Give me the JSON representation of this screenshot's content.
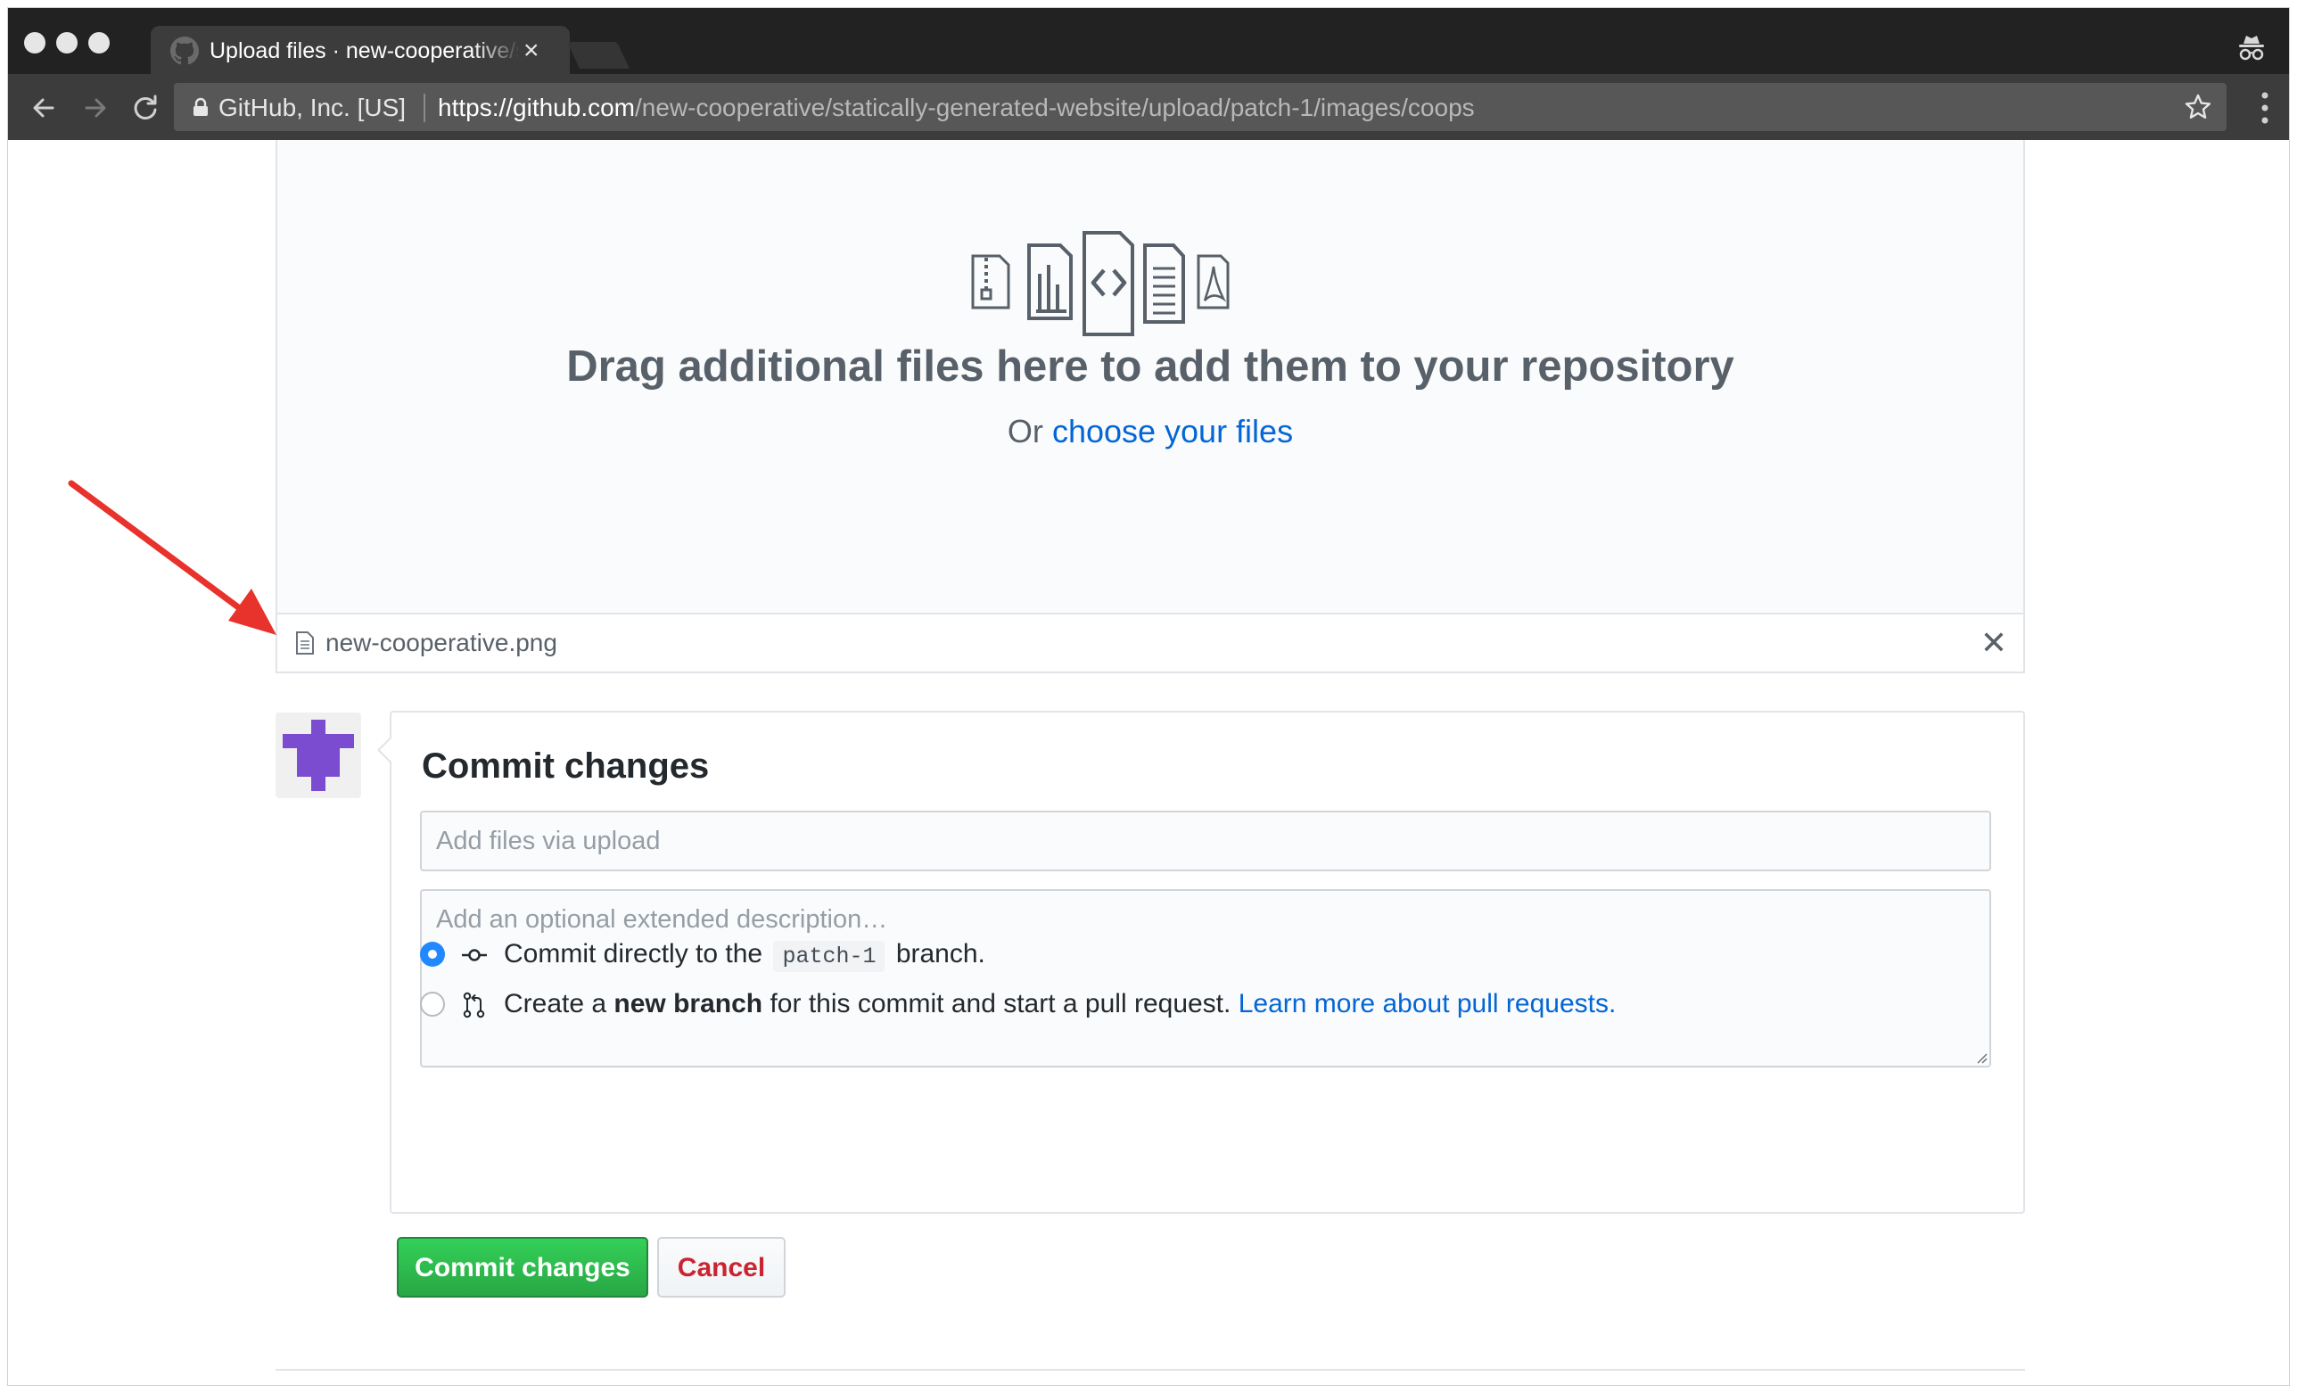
{
  "browser": {
    "tab_title": "Upload files · new-cooperative/statically-generated-website",
    "site_identity": "GitHub, Inc. [US]",
    "url_host": "https://github.com",
    "url_path": "/new-cooperative/statically-generated-website/upload/patch-1/images/coops"
  },
  "upload": {
    "drag_title": "Drag additional files here to add them to your repository",
    "or_text": "Or",
    "choose_link": "choose your files",
    "file_icons": [
      "file-zip-icon",
      "file-chart-icon",
      "file-code-icon",
      "file-text-icon",
      "file-pdf-icon"
    ],
    "files": [
      {
        "name": "new-cooperative.png",
        "icon": "file-icon"
      }
    ]
  },
  "commit": {
    "title": "Commit changes",
    "summary_placeholder": "Add files via upload",
    "description_placeholder": "Add an optional extended description…",
    "option_direct": {
      "prefix": "Commit directly to the",
      "branch": "patch-1",
      "suffix": "branch.",
      "selected": true
    },
    "option_new_branch": {
      "prefix": "Create a",
      "bold": "new branch",
      "suffix": "for this commit and start a pull request.",
      "link": "Learn more about pull requests.",
      "selected": false
    },
    "submit_label": "Commit changes",
    "cancel_label": "Cancel"
  },
  "colors": {
    "link": "#0366d6",
    "primary_button": "#28a745",
    "danger_text": "#cb2431",
    "radio_checked": "#2188ff",
    "annotation_arrow": "#e8322c",
    "avatar_identicon": "#7b4ccf"
  }
}
